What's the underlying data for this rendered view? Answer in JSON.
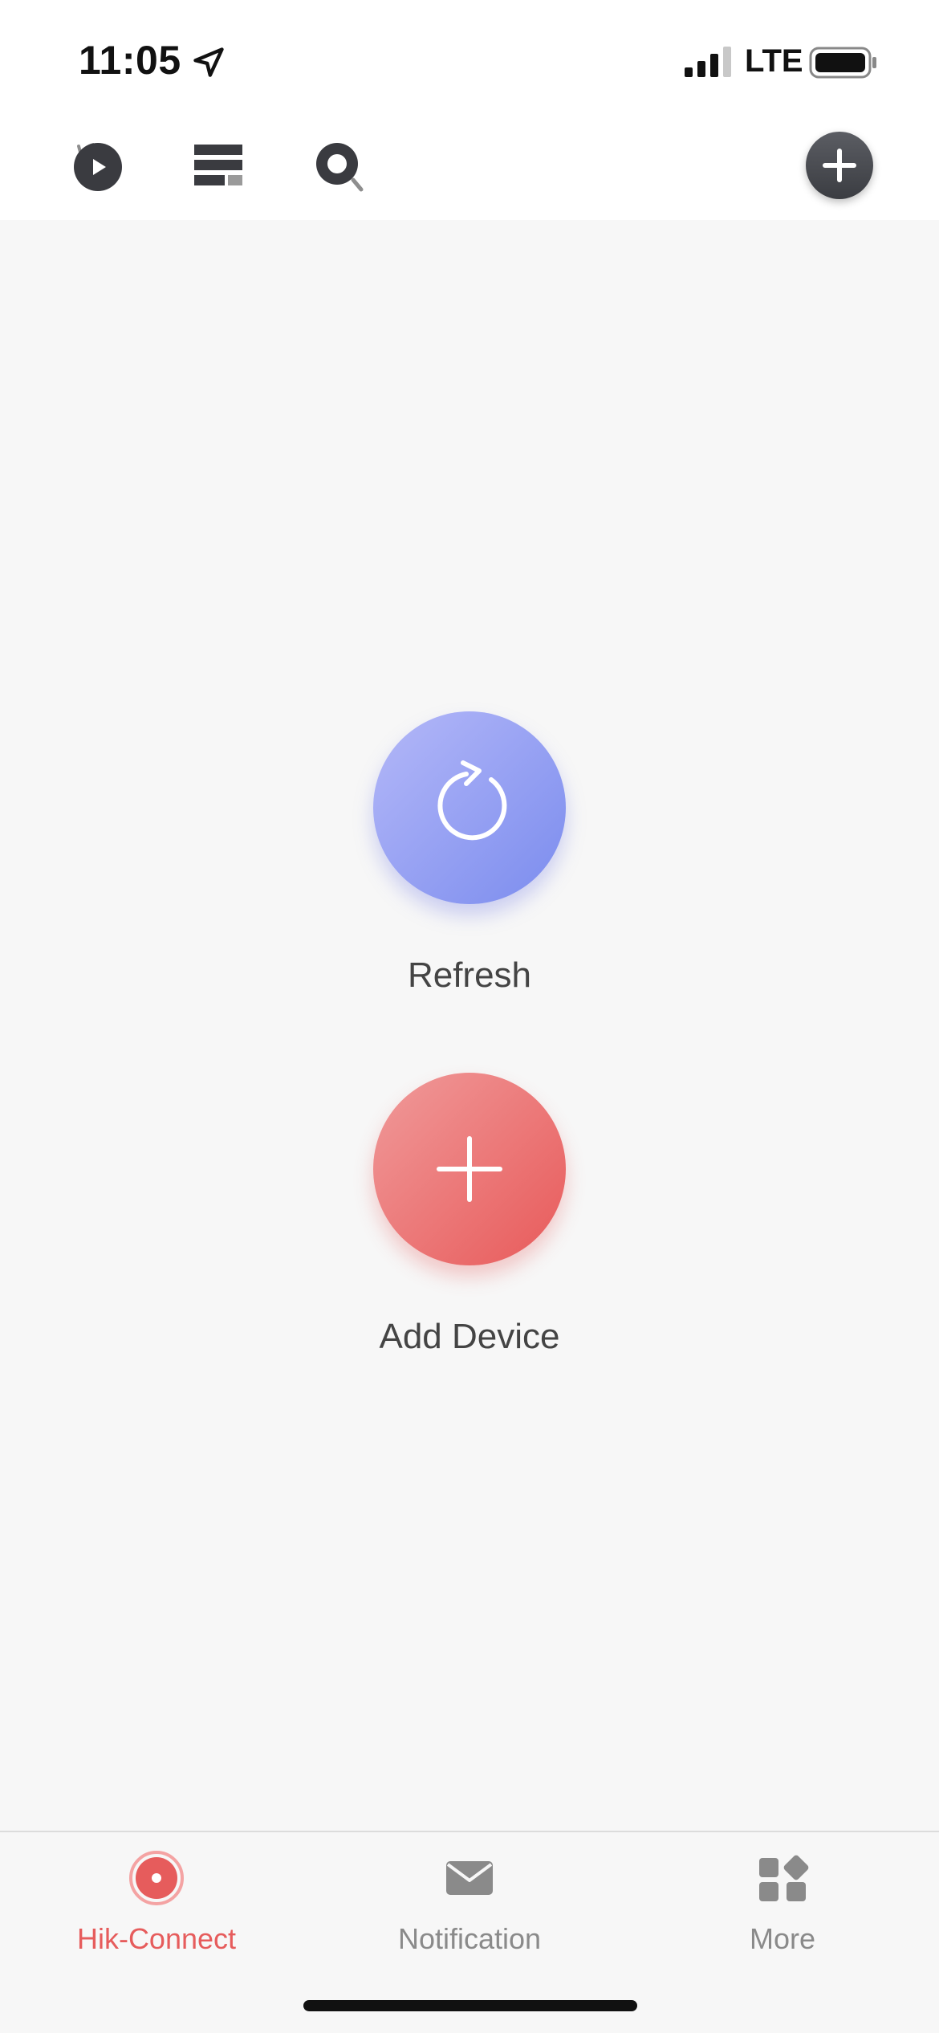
{
  "status_bar": {
    "time": "11:05",
    "network": "LTE",
    "location_icon": "location-arrow-icon",
    "signal_icon": "cellular-signal-icon",
    "battery_icon": "battery-icon"
  },
  "toolbar": {
    "items": [
      {
        "name": "playback",
        "icon": "playback-icon"
      },
      {
        "name": "layout",
        "icon": "list-layout-icon"
      },
      {
        "name": "search",
        "icon": "search-icon"
      }
    ],
    "add_icon": "plus-icon"
  },
  "actions": {
    "refresh_label": "Refresh",
    "add_device_label": "Add Device"
  },
  "tabs": [
    {
      "label": "Hik-Connect",
      "icon": "hik-connect-icon",
      "active": true
    },
    {
      "label": "Notification",
      "icon": "envelope-icon",
      "active": false
    },
    {
      "label": "More",
      "icon": "grid-more-icon",
      "active": false
    }
  ],
  "colors": {
    "accent": "#e65c5c",
    "refresh_gradient": [
      "#b4b8f8",
      "#7b8cee"
    ],
    "add_gradient": [
      "#f09a9a",
      "#e85a5a"
    ],
    "inactive_tab": "#8a8a8a"
  }
}
